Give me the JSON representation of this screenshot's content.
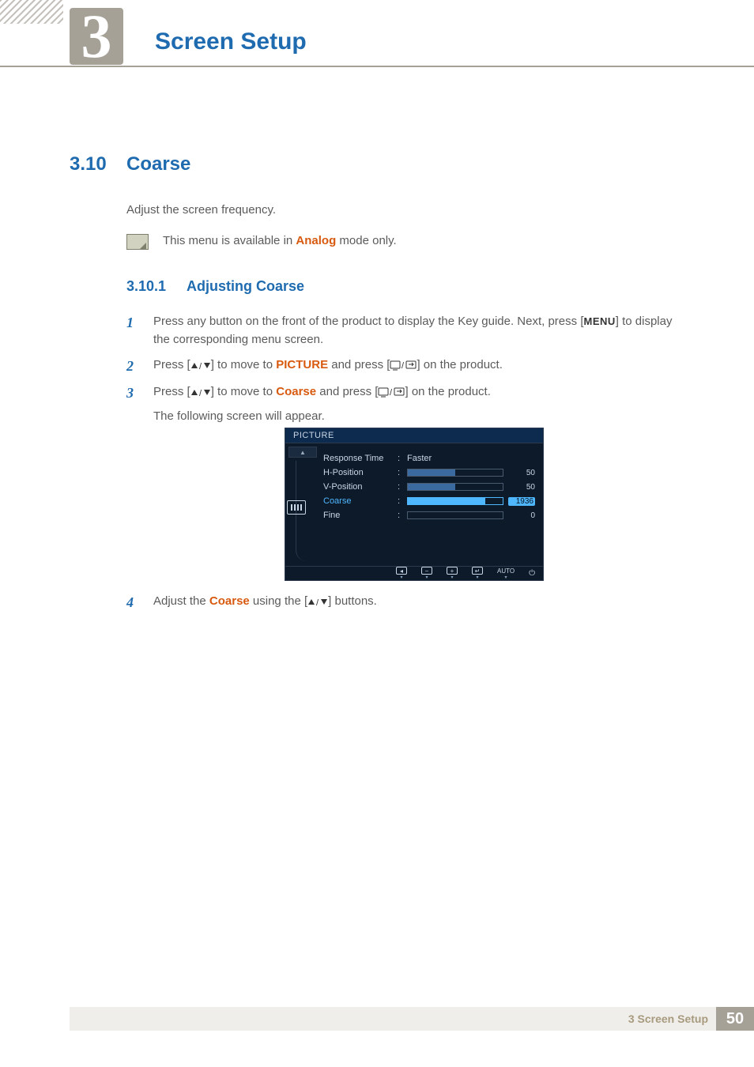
{
  "chapter": {
    "number": "3",
    "title": "Screen Setup"
  },
  "section": {
    "number": "3.10",
    "title": "Coarse"
  },
  "intro": "Adjust the screen frequency.",
  "note": {
    "prefix": "This menu is available in ",
    "mode": "Analog",
    "suffix": " mode only."
  },
  "subsection": {
    "number": "3.10.1",
    "title": "Adjusting Coarse"
  },
  "steps": {
    "s1": {
      "n": "1",
      "a": "Press any button on the front of the product to display the Key guide. Next, press [",
      "menu": "MENU",
      "b": "] to display the corresponding menu screen."
    },
    "s2": {
      "n": "2",
      "a": "Press [",
      "b": "] to move to ",
      "kw": "PICTURE",
      "c": " and press [",
      "d": "] on the product."
    },
    "s3": {
      "n": "3",
      "a": "Press [",
      "b": "] to move to ",
      "kw": "Coarse",
      "c": " and press [",
      "d": "] on the product.",
      "tail": "The following screen will appear."
    },
    "s4": {
      "n": "4",
      "a": "Adjust the ",
      "kw": "Coarse",
      "b": " using the [",
      "c": "] buttons."
    }
  },
  "osd": {
    "title": "PICTURE",
    "rows": {
      "r0": {
        "label": "Response Time",
        "value_text": "Faster"
      },
      "r1": {
        "label": "H-Position",
        "value": "50",
        "fill": 50
      },
      "r2": {
        "label": "V-Position",
        "value": "50",
        "fill": 50
      },
      "r3": {
        "label": "Coarse",
        "value": "1936",
        "fill": 82,
        "selected": true
      },
      "r4": {
        "label": "Fine",
        "value": "0",
        "fill": 0
      }
    },
    "footer": {
      "auto": "AUTO"
    }
  },
  "footer": {
    "text": "3 Screen Setup",
    "page": "50"
  }
}
